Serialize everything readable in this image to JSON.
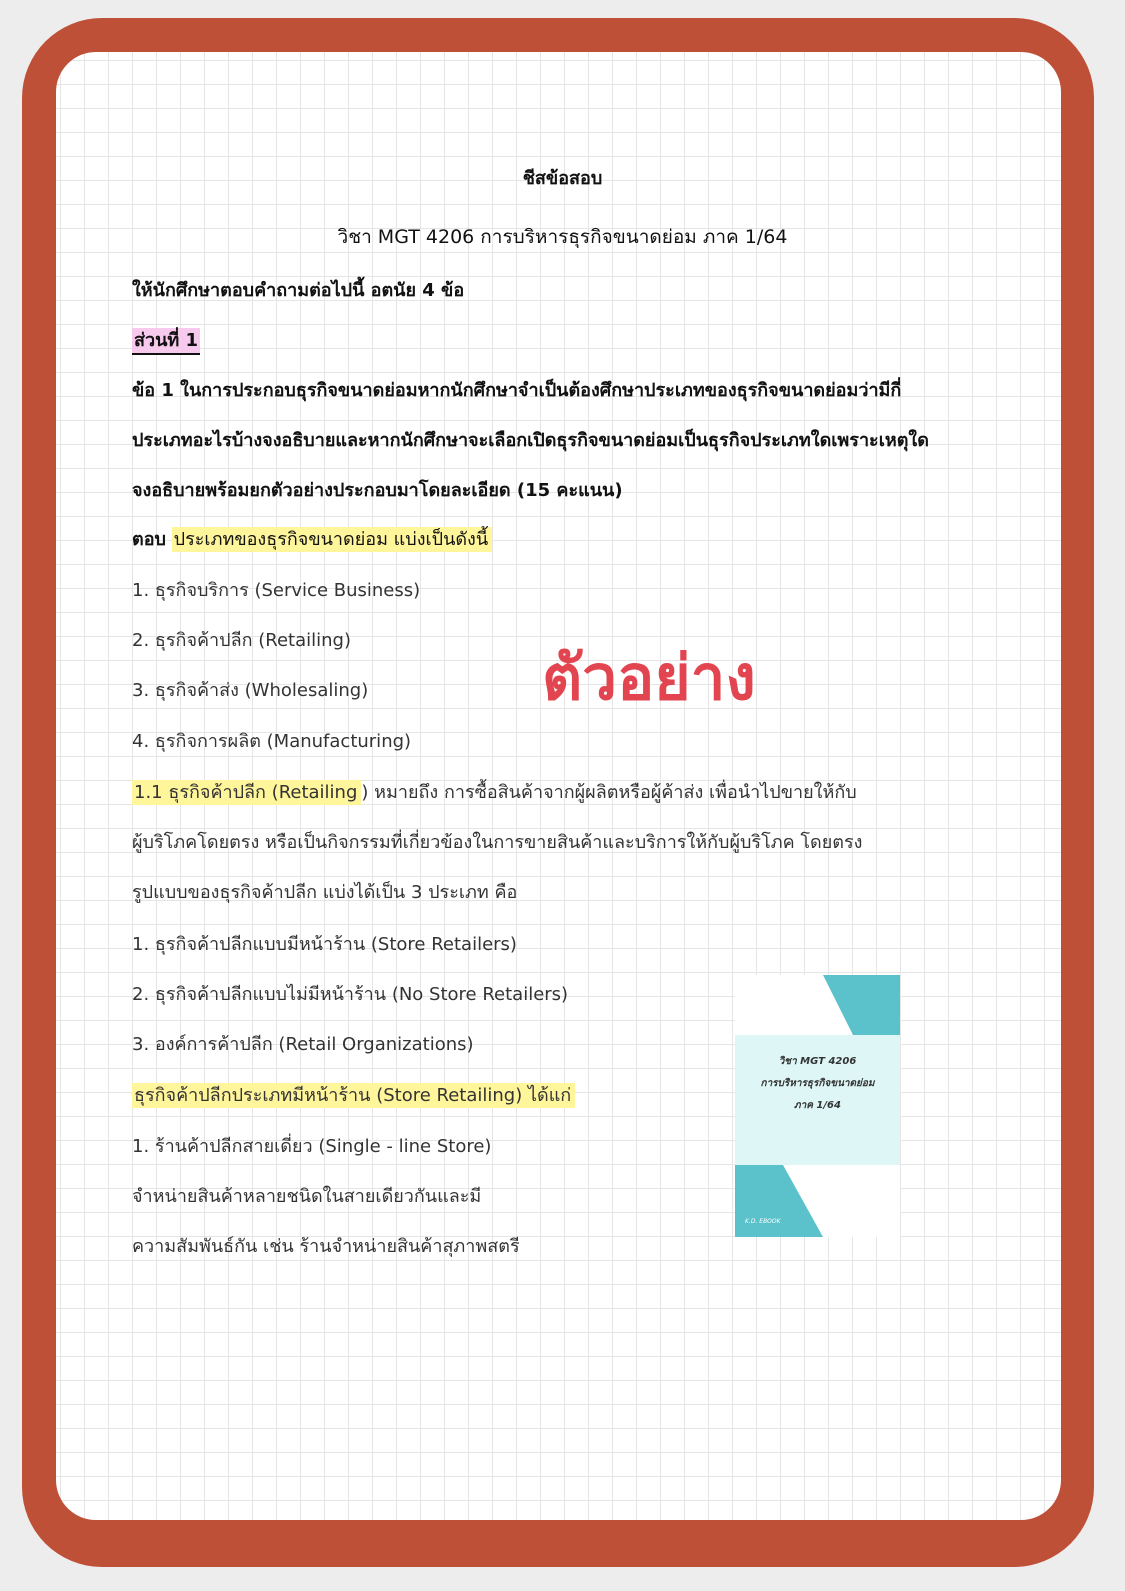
{
  "document": {
    "title": "ชีสข้อสอบ",
    "subtitle": "วิชา MGT 4206  การบริหารธุรกิจขนาดย่อม ภาค 1/64",
    "instruction": "ให้นักศึกษาตอบคำถามต่อไปนี้ อตนัย 4 ข้อ",
    "part_label": "ส่วนที่ 1",
    "question_lines": [
      "ข้อ 1 ในการประกอบธุรกิจขนาดย่อมหากนักศึกษาจำเป็นต้องศึกษาประเภทของธุรกิจขนาดย่อมว่ามีกี่",
      "ประเภทอะไรบ้างจงอธิบายและหากนักศึกษาจะเลือกเปิดธุรกิจขนาดย่อมเป็นธุรกิจประเภทใดเพราะเหตุใด",
      "จงอธิบายพร้อมยกตัวอย่างประกอบมาโดยละเอียด (15 คะแนน)"
    ],
    "answer_prefix": "ตอบ",
    "answer_highlight": "ประเภทของธุรกิจขนาดย่อม แบ่งเป็นดังนี้",
    "types": [
      "1. ธุรกิจบริการ (Service Business)",
      "2. ธุรกิจค้าปลีก (Retailing)",
      "3. ธุรกิจค้าส่ง (Wholesaling)",
      "4. ธุรกิจการผลิต (Manufacturing)"
    ],
    "retail_highlight": "1.1 ธุรกิจค้าปลีก (Retailing",
    "retail_rest": ") หมายถึง การซื้อสินค้าจากผู้ผลิตหรือผู้ค้าส่ง เพื่อนำไปขายให้กับ",
    "retail_line2": "ผู้บริโภคโดยตรง หรือเป็นกิจกรรมที่เกี่ยวข้องในการขายสินค้าและบริการให้กับผู้บริโภค โดยตรง",
    "retail_line3": "รูปแบบของธุรกิจค้าปลีก แบ่งได้เป็น 3 ประเภท คือ",
    "retail_types": [
      "1. ธุรกิจค้าปลีกแบบมีหน้าร้าน (Store Retailers)",
      "2. ธุรกิจค้าปลีกแบบไม่มีหน้าร้าน (No Store Retailers)",
      "3. องค์การค้าปลีก (Retail Organizations)"
    ],
    "store_highlight": "ธุรกิจค้าปลีกประเภทมีหน้าร้าน (Store Retailing) ได้แก่",
    "store_line1": "1. ร้านค้าปลีกสายเดี่ยว (Single - line Store)",
    "store_line2": "จำหน่ายสินค้าหลายชนิดในสายเดียวกันและมี",
    "store_line3": "ความสัมพันธ์กัน เช่น ร้านจำหน่ายสินค้าสุภาพสตรี"
  },
  "watermark": "ตัวอย่าง",
  "cover": {
    "line1": "วิชา MGT 4206",
    "line2": "การบริหารธุรกิจขนาดย่อม",
    "line3": "ภาค 1/64",
    "brand": "K.D. EBOOK"
  },
  "colors": {
    "frame": "#bf5038",
    "highlight_yellow": "#fff59a",
    "highlight_pink": "#f7c9ec",
    "watermark": "#e2454f",
    "cover_teal": "#5bc2cb",
    "cover_light": "#def6f6"
  }
}
